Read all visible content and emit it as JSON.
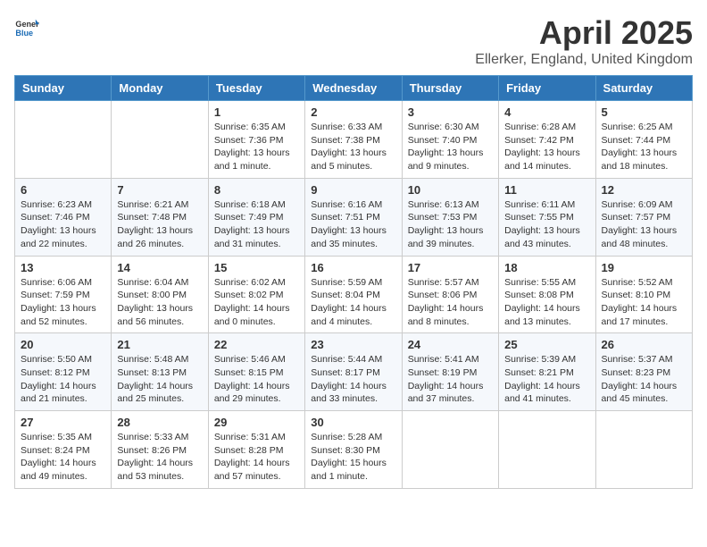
{
  "header": {
    "logo_general": "General",
    "logo_blue": "Blue",
    "month_title": "April 2025",
    "location": "Ellerker, England, United Kingdom"
  },
  "days_of_week": [
    "Sunday",
    "Monday",
    "Tuesday",
    "Wednesday",
    "Thursday",
    "Friday",
    "Saturday"
  ],
  "weeks": [
    [
      {
        "day": "",
        "info": ""
      },
      {
        "day": "",
        "info": ""
      },
      {
        "day": "1",
        "info": "Sunrise: 6:35 AM\nSunset: 7:36 PM\nDaylight: 13 hours and 1 minute."
      },
      {
        "day": "2",
        "info": "Sunrise: 6:33 AM\nSunset: 7:38 PM\nDaylight: 13 hours and 5 minutes."
      },
      {
        "day": "3",
        "info": "Sunrise: 6:30 AM\nSunset: 7:40 PM\nDaylight: 13 hours and 9 minutes."
      },
      {
        "day": "4",
        "info": "Sunrise: 6:28 AM\nSunset: 7:42 PM\nDaylight: 13 hours and 14 minutes."
      },
      {
        "day": "5",
        "info": "Sunrise: 6:25 AM\nSunset: 7:44 PM\nDaylight: 13 hours and 18 minutes."
      }
    ],
    [
      {
        "day": "6",
        "info": "Sunrise: 6:23 AM\nSunset: 7:46 PM\nDaylight: 13 hours and 22 minutes."
      },
      {
        "day": "7",
        "info": "Sunrise: 6:21 AM\nSunset: 7:48 PM\nDaylight: 13 hours and 26 minutes."
      },
      {
        "day": "8",
        "info": "Sunrise: 6:18 AM\nSunset: 7:49 PM\nDaylight: 13 hours and 31 minutes."
      },
      {
        "day": "9",
        "info": "Sunrise: 6:16 AM\nSunset: 7:51 PM\nDaylight: 13 hours and 35 minutes."
      },
      {
        "day": "10",
        "info": "Sunrise: 6:13 AM\nSunset: 7:53 PM\nDaylight: 13 hours and 39 minutes."
      },
      {
        "day": "11",
        "info": "Sunrise: 6:11 AM\nSunset: 7:55 PM\nDaylight: 13 hours and 43 minutes."
      },
      {
        "day": "12",
        "info": "Sunrise: 6:09 AM\nSunset: 7:57 PM\nDaylight: 13 hours and 48 minutes."
      }
    ],
    [
      {
        "day": "13",
        "info": "Sunrise: 6:06 AM\nSunset: 7:59 PM\nDaylight: 13 hours and 52 minutes."
      },
      {
        "day": "14",
        "info": "Sunrise: 6:04 AM\nSunset: 8:00 PM\nDaylight: 13 hours and 56 minutes."
      },
      {
        "day": "15",
        "info": "Sunrise: 6:02 AM\nSunset: 8:02 PM\nDaylight: 14 hours and 0 minutes."
      },
      {
        "day": "16",
        "info": "Sunrise: 5:59 AM\nSunset: 8:04 PM\nDaylight: 14 hours and 4 minutes."
      },
      {
        "day": "17",
        "info": "Sunrise: 5:57 AM\nSunset: 8:06 PM\nDaylight: 14 hours and 8 minutes."
      },
      {
        "day": "18",
        "info": "Sunrise: 5:55 AM\nSunset: 8:08 PM\nDaylight: 14 hours and 13 minutes."
      },
      {
        "day": "19",
        "info": "Sunrise: 5:52 AM\nSunset: 8:10 PM\nDaylight: 14 hours and 17 minutes."
      }
    ],
    [
      {
        "day": "20",
        "info": "Sunrise: 5:50 AM\nSunset: 8:12 PM\nDaylight: 14 hours and 21 minutes."
      },
      {
        "day": "21",
        "info": "Sunrise: 5:48 AM\nSunset: 8:13 PM\nDaylight: 14 hours and 25 minutes."
      },
      {
        "day": "22",
        "info": "Sunrise: 5:46 AM\nSunset: 8:15 PM\nDaylight: 14 hours and 29 minutes."
      },
      {
        "day": "23",
        "info": "Sunrise: 5:44 AM\nSunset: 8:17 PM\nDaylight: 14 hours and 33 minutes."
      },
      {
        "day": "24",
        "info": "Sunrise: 5:41 AM\nSunset: 8:19 PM\nDaylight: 14 hours and 37 minutes."
      },
      {
        "day": "25",
        "info": "Sunrise: 5:39 AM\nSunset: 8:21 PM\nDaylight: 14 hours and 41 minutes."
      },
      {
        "day": "26",
        "info": "Sunrise: 5:37 AM\nSunset: 8:23 PM\nDaylight: 14 hours and 45 minutes."
      }
    ],
    [
      {
        "day": "27",
        "info": "Sunrise: 5:35 AM\nSunset: 8:24 PM\nDaylight: 14 hours and 49 minutes."
      },
      {
        "day": "28",
        "info": "Sunrise: 5:33 AM\nSunset: 8:26 PM\nDaylight: 14 hours and 53 minutes."
      },
      {
        "day": "29",
        "info": "Sunrise: 5:31 AM\nSunset: 8:28 PM\nDaylight: 14 hours and 57 minutes."
      },
      {
        "day": "30",
        "info": "Sunrise: 5:28 AM\nSunset: 8:30 PM\nDaylight: 15 hours and 1 minute."
      },
      {
        "day": "",
        "info": ""
      },
      {
        "day": "",
        "info": ""
      },
      {
        "day": "",
        "info": ""
      }
    ]
  ]
}
